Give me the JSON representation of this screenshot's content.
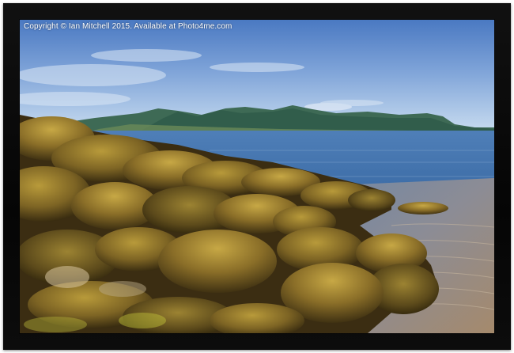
{
  "photo": {
    "copyright": "Copyright © Ian Mitchell 2015. Available at Photo4me.com"
  },
  "colors": {
    "frame": "#0a0a0a",
    "sky_top": "#4f7fc6",
    "sky_bottom": "#bcd4ee",
    "sea": "#3d6fa8",
    "hills": "#3c6a52",
    "rock_light": "#a78a33",
    "rock_dark": "#3a2d12",
    "sand": "#8a7a6a"
  },
  "icons": {
    "frame": "black-picture-frame"
  }
}
